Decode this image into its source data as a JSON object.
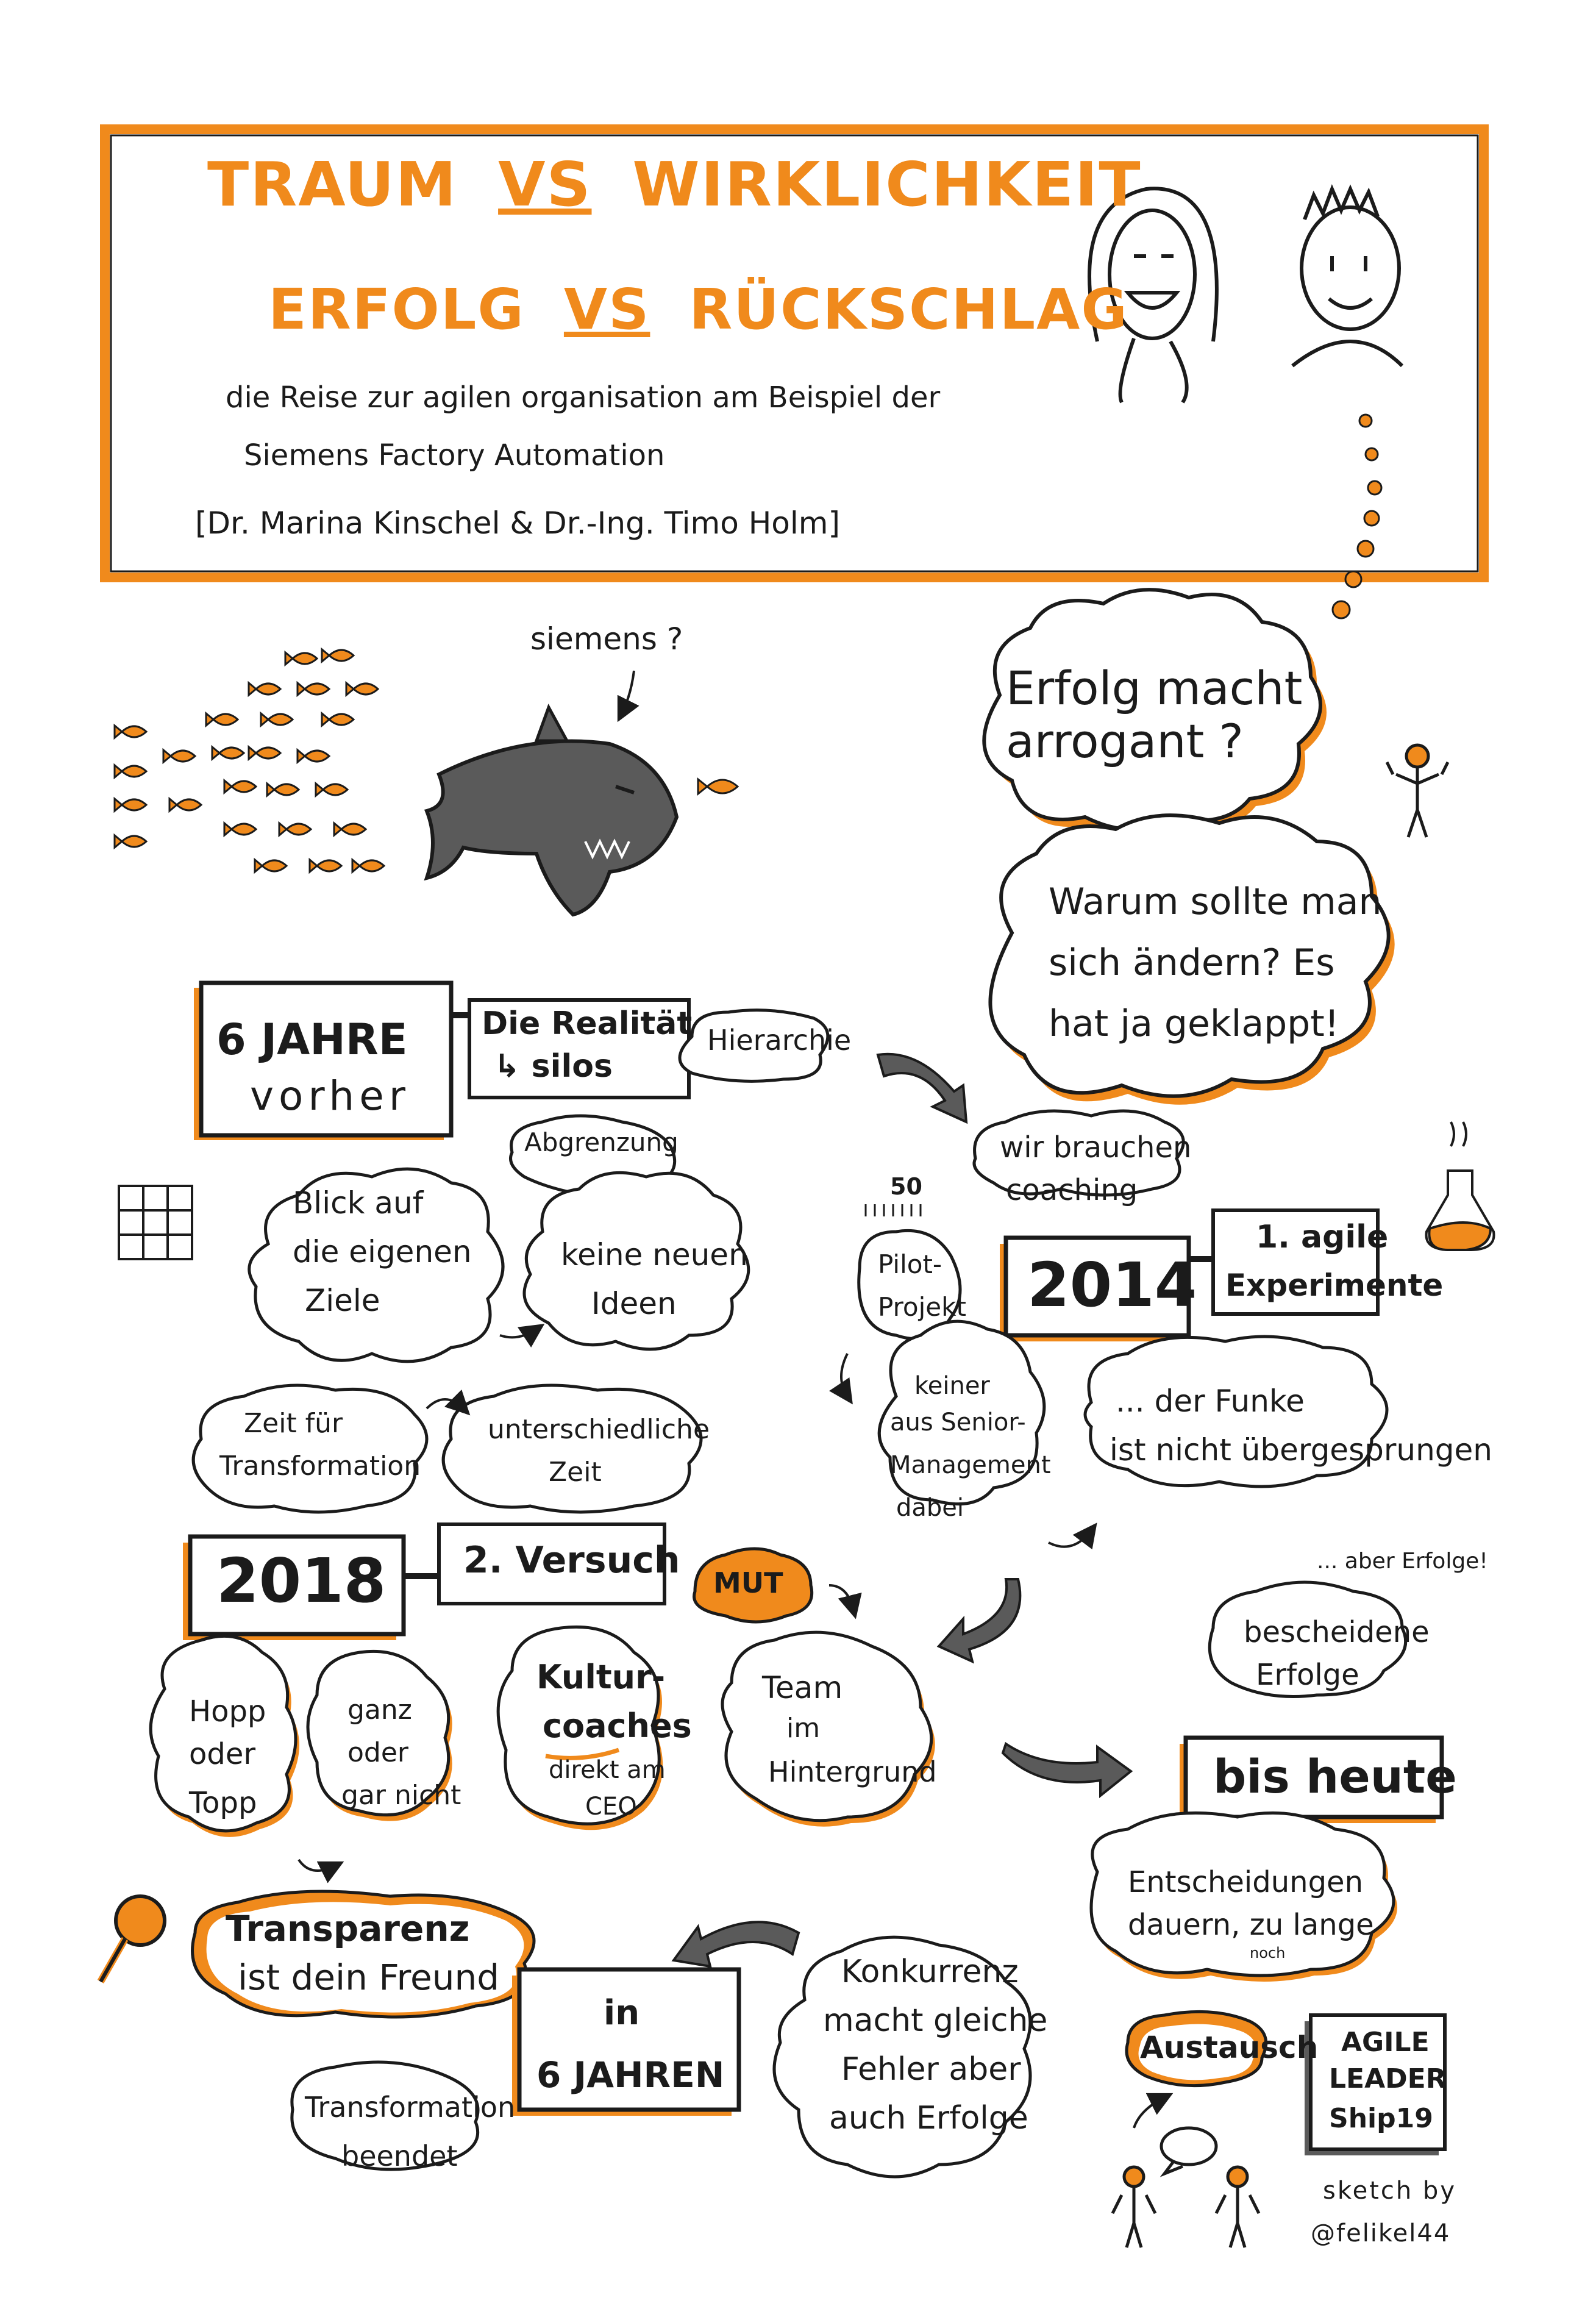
{
  "colors": {
    "accent": "#f08a1c",
    "ink": "#1b1b1b",
    "gray": "#555555",
    "paper": "#ffffff"
  },
  "header": {
    "title_line1_a": "TRAUM",
    "title_line1_vs": "VS",
    "title_line1_b": "WIRKLICHKEIT",
    "title_line2_a": "ERFOLG",
    "title_line2_vs": "VS",
    "title_line2_b": "RÜCKSCHLAG",
    "subtitle_1": "die Reise zur agilen organisation am Beispiel der",
    "subtitle_2": "Siemens Factory Automation",
    "speakers": "[Dr. Marina Kinschel & Dr.-Ing. Timo Holm]"
  },
  "fish_scene": {
    "label": "siemens ?"
  },
  "thoughts": {
    "arrogant": "Erfolg macht arrogant ?",
    "change_1": "Warum sollte man",
    "change_2": "sich ändern? Es",
    "change_3": "hat ja geklappt!"
  },
  "six_years": {
    "box_1": "6 JAHRE",
    "box_2": "vorher",
    "reality_1": "Die Realität",
    "reality_2": "↳ silos",
    "hierarchy": "Hierarchie",
    "abgrenzung": "Abgrenzung",
    "blick_1": "Blick auf",
    "blick_2": "die eigenen",
    "blick_3": "Ziele",
    "ideen_1": "keine neuen",
    "ideen_2": "Ideen"
  },
  "y2014": {
    "year": "2014",
    "fifty": "50",
    "coaching_1": "wir brauchen",
    "coaching_2": "coaching",
    "exp_1": "1. agile",
    "exp_2": "Experimente",
    "pilot_1": "Pilot-",
    "pilot_2": "Projekt",
    "senior_1": "keiner",
    "senior_2": "aus Senior-",
    "senior_3": "Management",
    "senior_4": "dabei",
    "funke_1": "... der Funke",
    "funke_2": "ist nicht übergesprungen"
  },
  "transformation_time": {
    "zeit_1": "Zeit für",
    "zeit_2": "Transformation",
    "diff_1": "unterschiedliche",
    "diff_2": "Zeit"
  },
  "y2018": {
    "year": "2018",
    "attempt": "2. Versuch",
    "mut": "MUT",
    "hopp_1": "Hopp",
    "hopp_2": "oder",
    "hopp_3": "Topp",
    "ganz_1": "ganz",
    "ganz_2": "oder",
    "ganz_3": "gar nicht",
    "kultur_1": "Kultur-",
    "kultur_2": "coaches",
    "kultur_3": "direkt am",
    "kultur_4": "CEO",
    "team_1": "Team",
    "team_2": "im",
    "team_3": "Hintergrund"
  },
  "today": {
    "aber": "... aber Erfolge!",
    "besch_1": "bescheidene",
    "besch_2": "Erfolge",
    "bis_heute": "bis heute",
    "ent_1": "Entscheidungen",
    "ent_2": "dauern, zu lange",
    "ent_3": "noch"
  },
  "future": {
    "transp_1": "Transparenz",
    "transp_2": "ist dein Freund",
    "in": "in",
    "six_years": "6 JAHREN",
    "beendet_1": "Transformation",
    "beendet_2": "beendet",
    "konk_1": "Konkurrenz",
    "konk_2": "macht gleiche",
    "konk_3": "Fehler aber",
    "konk_4": "auch Erfolge",
    "austausch": "Austausch",
    "badge_1": "AGILE",
    "badge_2": "LEADER",
    "badge_3": "Ship19",
    "credit_1": "sketch by",
    "credit_2": "@felikel44"
  }
}
